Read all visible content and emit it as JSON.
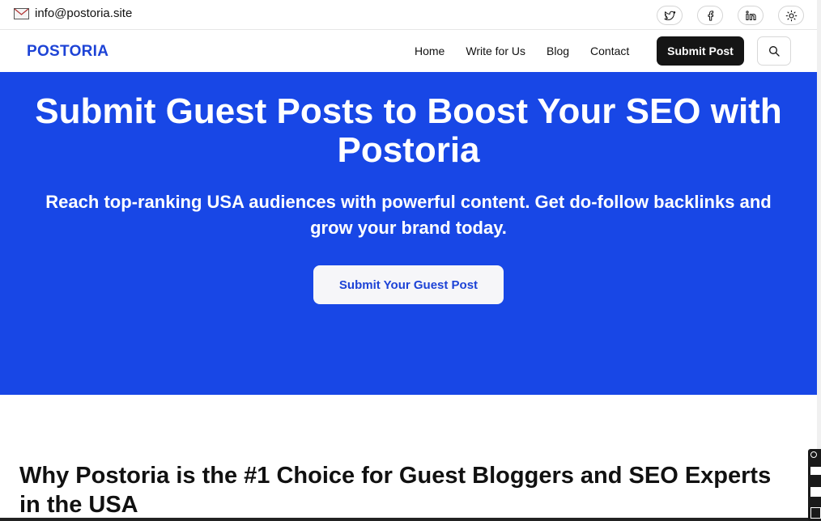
{
  "topbar": {
    "email": "info@postoria.site",
    "icons": [
      "mail-icon",
      "twitter-icon",
      "facebook-icon",
      "linkedin-icon",
      "theme-toggle-icon"
    ]
  },
  "nav": {
    "logo": "POSTORIA",
    "links": [
      "Home",
      "Write for Us",
      "Blog",
      "Contact"
    ],
    "submit_label": "Submit Post"
  },
  "hero": {
    "title": "Submit Guest Posts to Boost Your SEO with Postoria",
    "subtitle": "Reach top-ranking USA audiences with powerful content. Get do-follow backlinks and grow your brand today.",
    "cta_label": "Submit Your Guest Post"
  },
  "section": {
    "title": "Why Postoria is the #1 Choice for Guest Bloggers and SEO Experts in the USA"
  },
  "colors": {
    "brand": "#1d43d6",
    "hero_bg": "#1847e6",
    "button_dark": "#151515"
  }
}
